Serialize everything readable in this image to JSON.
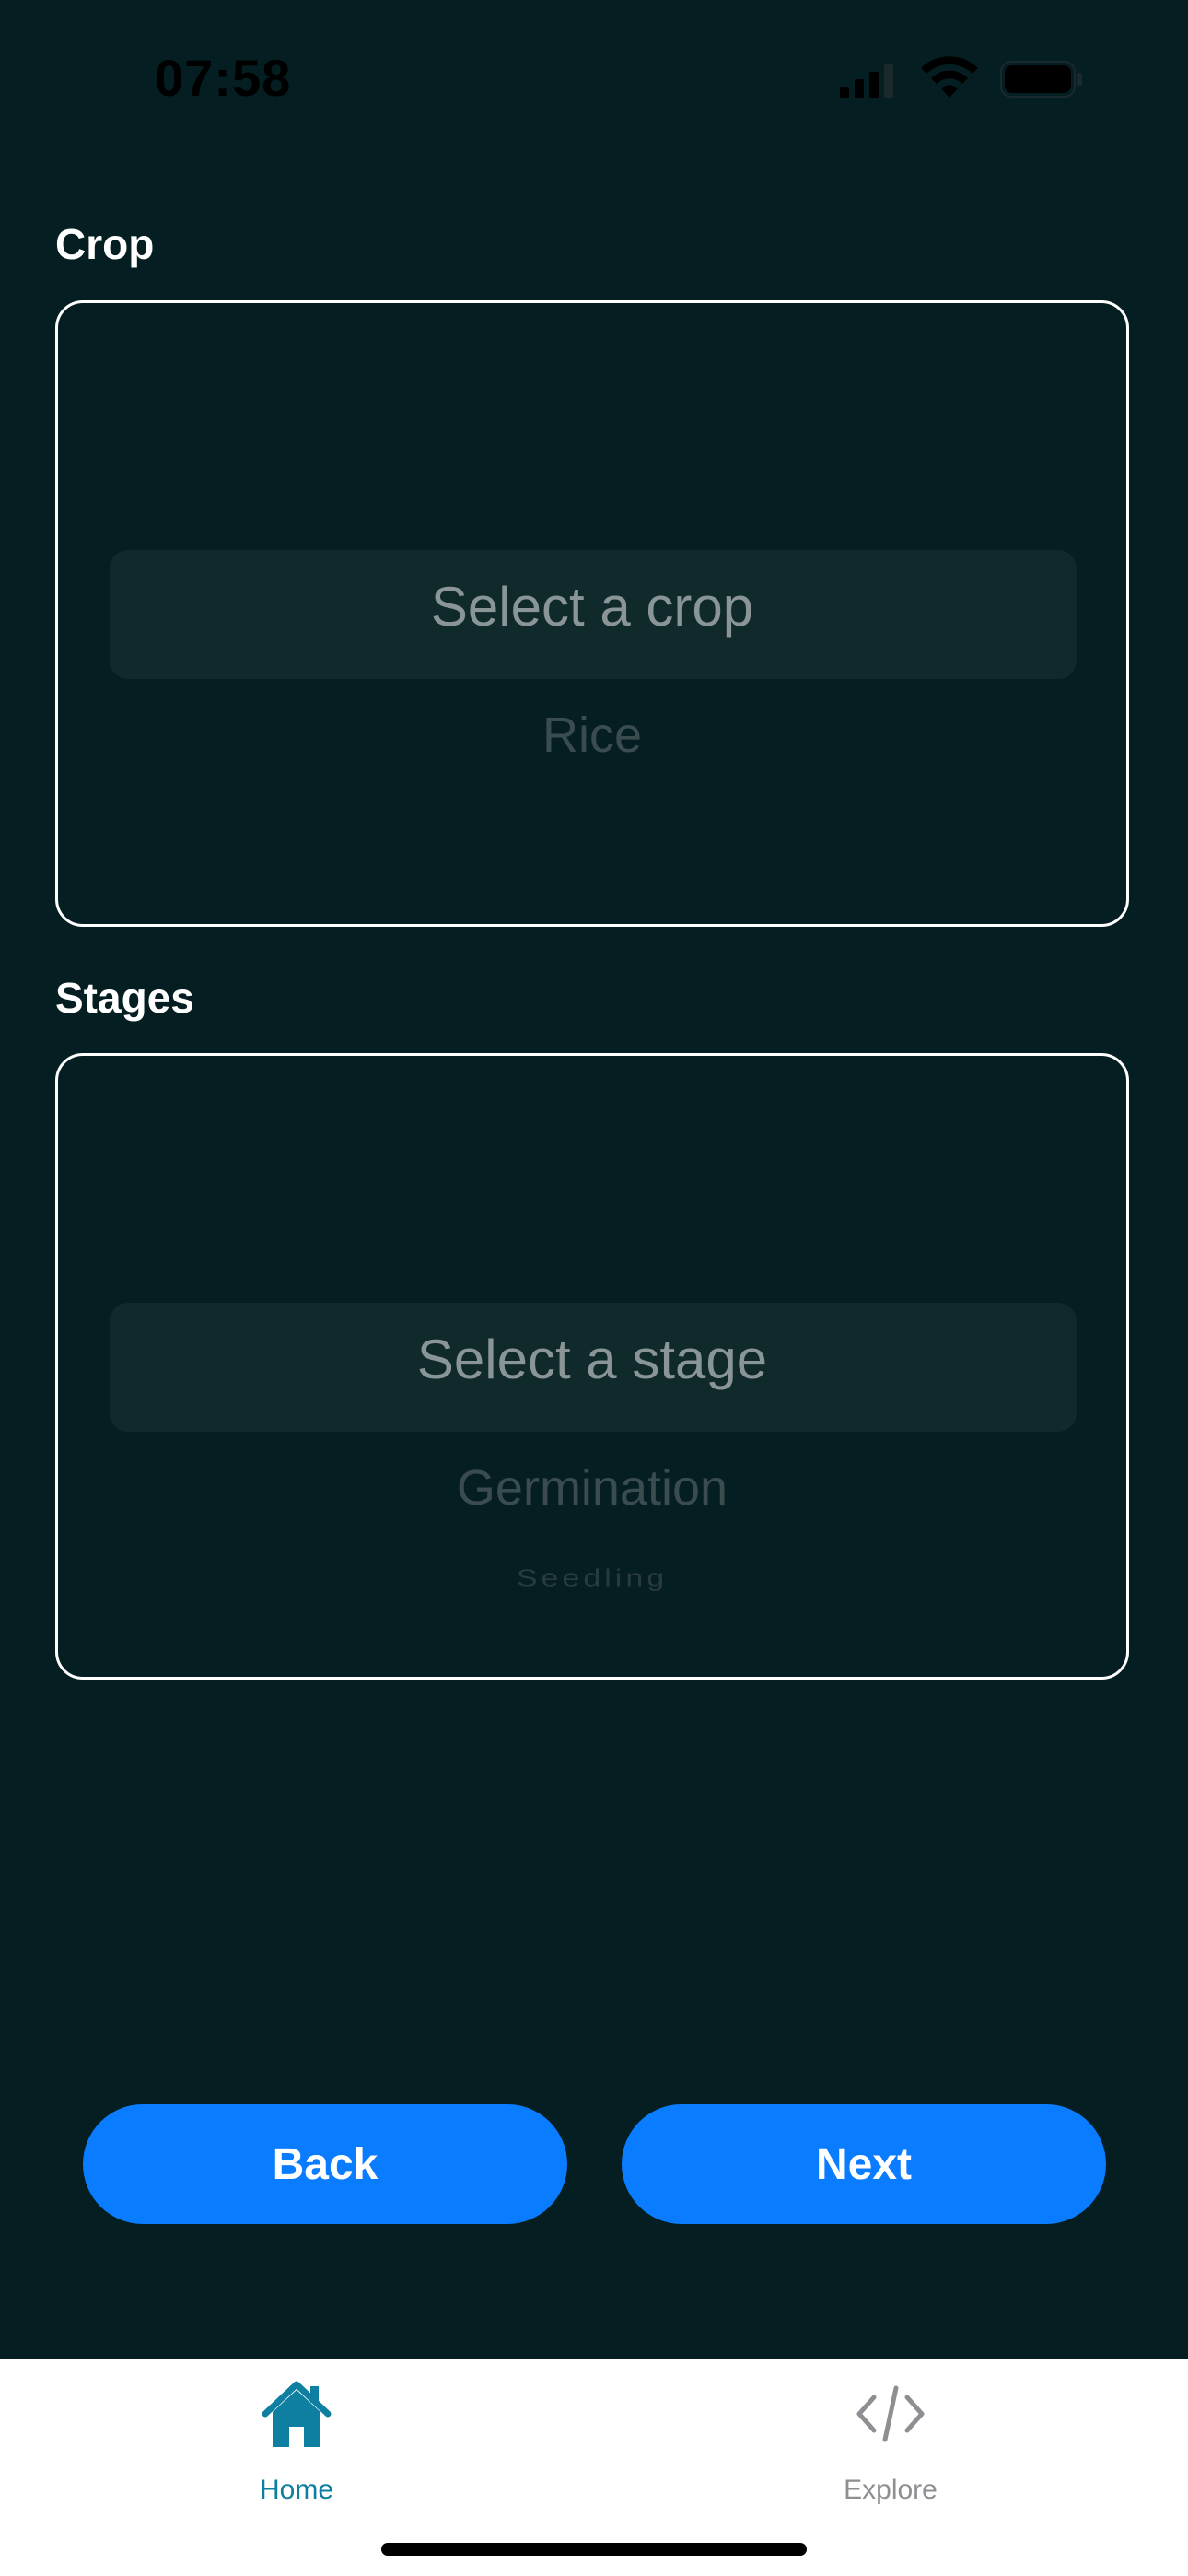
{
  "status_bar": {
    "time": "07:58"
  },
  "crop": {
    "label": "Crop",
    "selected": "Select a crop",
    "options": [
      "Rice"
    ]
  },
  "stage": {
    "label": "Stages",
    "selected": "Select a stage",
    "options": [
      "Germination",
      "Seedling"
    ]
  },
  "buttons": {
    "back": "Back",
    "next": "Next"
  },
  "tab_bar": {
    "tabs": [
      {
        "label": "Home",
        "icon": "home-icon",
        "active": true
      },
      {
        "label": "Explore",
        "icon": "code-icon",
        "active": false
      }
    ]
  },
  "colors": {
    "background": "#041e21",
    "accent": "#0a7cff",
    "active_tab": "#0e7fa0",
    "inactive_tab": "#8e8e93"
  }
}
